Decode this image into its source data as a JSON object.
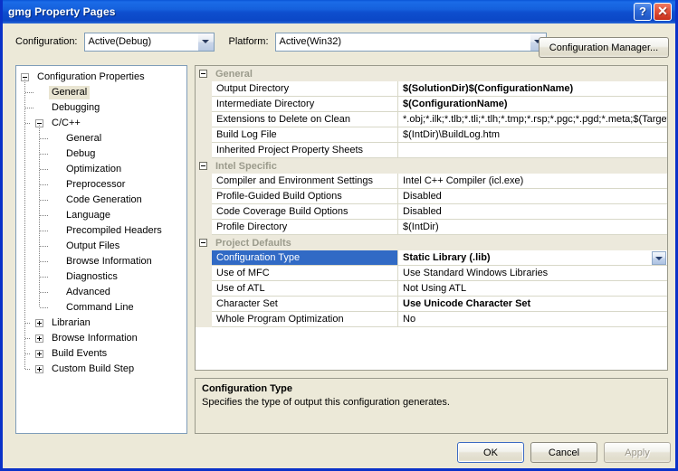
{
  "window": {
    "title": "gmg Property Pages",
    "help_button": "?",
    "close_button": "✕"
  },
  "configbar": {
    "configuration_label": "Configuration:",
    "configuration_value": "Active(Debug)",
    "platform_label": "Platform:",
    "platform_value": "Active(Win32)",
    "configuration_manager_button": "Configuration Manager..."
  },
  "tree": {
    "nodes": [
      {
        "label": "Configuration Properties",
        "level": 0,
        "expander": "minus",
        "selected": false
      },
      {
        "label": "General",
        "level": 1,
        "expander": "none",
        "selected": true
      },
      {
        "label": "Debugging",
        "level": 1,
        "expander": "none",
        "selected": false
      },
      {
        "label": "C/C++",
        "level": 1,
        "expander": "minus",
        "selected": false
      },
      {
        "label": "General",
        "level": 2,
        "expander": "none",
        "selected": false
      },
      {
        "label": "Debug",
        "level": 2,
        "expander": "none",
        "selected": false
      },
      {
        "label": "Optimization",
        "level": 2,
        "expander": "none",
        "selected": false
      },
      {
        "label": "Preprocessor",
        "level": 2,
        "expander": "none",
        "selected": false
      },
      {
        "label": "Code Generation",
        "level": 2,
        "expander": "none",
        "selected": false
      },
      {
        "label": "Language",
        "level": 2,
        "expander": "none",
        "selected": false
      },
      {
        "label": "Precompiled Headers",
        "level": 2,
        "expander": "none",
        "selected": false
      },
      {
        "label": "Output Files",
        "level": 2,
        "expander": "none",
        "selected": false
      },
      {
        "label": "Browse Information",
        "level": 2,
        "expander": "none",
        "selected": false
      },
      {
        "label": "Diagnostics",
        "level": 2,
        "expander": "none",
        "selected": false
      },
      {
        "label": "Advanced",
        "level": 2,
        "expander": "none",
        "selected": false
      },
      {
        "label": "Command Line",
        "level": 2,
        "expander": "none",
        "selected": false
      },
      {
        "label": "Librarian",
        "level": 1,
        "expander": "plus",
        "selected": false
      },
      {
        "label": "Browse Information",
        "level": 1,
        "expander": "plus",
        "selected": false
      },
      {
        "label": "Build Events",
        "level": 1,
        "expander": "plus",
        "selected": false
      },
      {
        "label": "Custom Build Step",
        "level": 1,
        "expander": "plus",
        "selected": false
      }
    ]
  },
  "grid": {
    "rows": [
      {
        "type": "group",
        "name": "General"
      },
      {
        "type": "prop",
        "name": "Output Directory",
        "value": "$(SolutionDir)$(ConfigurationName)",
        "bold": true,
        "selected": false,
        "dropdown": false
      },
      {
        "type": "prop",
        "name": "Intermediate Directory",
        "value": "$(ConfigurationName)",
        "bold": true,
        "selected": false,
        "dropdown": false
      },
      {
        "type": "prop",
        "name": "Extensions to Delete on Clean",
        "value": "*.obj;*.ilk;*.tlb;*.tli;*.tlh;*.tmp;*.rsp;*.pgc;*.pgd;*.meta;$(TargetPath)",
        "bold": false,
        "selected": false,
        "dropdown": false
      },
      {
        "type": "prop",
        "name": "Build Log File",
        "value": "$(IntDir)\\BuildLog.htm",
        "bold": false,
        "selected": false,
        "dropdown": false
      },
      {
        "type": "prop",
        "name": "Inherited Project Property Sheets",
        "value": "",
        "bold": false,
        "selected": false,
        "dropdown": false
      },
      {
        "type": "group",
        "name": "Intel Specific"
      },
      {
        "type": "prop",
        "name": "Compiler and Environment Settings",
        "value": "Intel C++ Compiler (icl.exe)",
        "bold": false,
        "selected": false,
        "dropdown": false
      },
      {
        "type": "prop",
        "name": "Profile-Guided Build Options",
        "value": "Disabled",
        "bold": false,
        "selected": false,
        "dropdown": false
      },
      {
        "type": "prop",
        "name": "Code Coverage Build Options",
        "value": "Disabled",
        "bold": false,
        "selected": false,
        "dropdown": false
      },
      {
        "type": "prop",
        "name": "Profile Directory",
        "value": "$(IntDir)",
        "bold": false,
        "selected": false,
        "dropdown": false
      },
      {
        "type": "group",
        "name": "Project Defaults"
      },
      {
        "type": "prop",
        "name": "Configuration Type",
        "value": "Static Library (.lib)",
        "bold": true,
        "selected": true,
        "dropdown": true
      },
      {
        "type": "prop",
        "name": "Use of MFC",
        "value": "Use Standard Windows Libraries",
        "bold": false,
        "selected": false,
        "dropdown": false
      },
      {
        "type": "prop",
        "name": "Use of ATL",
        "value": "Not Using ATL",
        "bold": false,
        "selected": false,
        "dropdown": false
      },
      {
        "type": "prop",
        "name": "Character Set",
        "value": "Use Unicode Character Set",
        "bold": true,
        "selected": false,
        "dropdown": false
      },
      {
        "type": "prop",
        "name": "Whole Program Optimization",
        "value": "No",
        "bold": false,
        "selected": false,
        "dropdown": false
      }
    ]
  },
  "description": {
    "title": "Configuration Type",
    "body": "Specifies the type of output this configuration generates."
  },
  "buttons": {
    "ok": "OK",
    "cancel": "Cancel",
    "apply": "Apply"
  },
  "colors": {
    "titlebar_blue": "#0E4FCF",
    "dialog_face": "#ECE9D8",
    "selection_blue": "#316AC5",
    "group_header": "#ECE9DC",
    "tree_selection": "#E9E5D2"
  }
}
